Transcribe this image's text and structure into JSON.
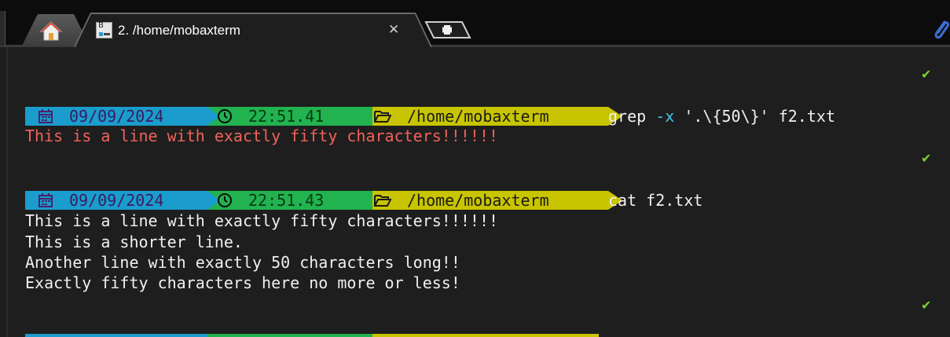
{
  "tabs": {
    "home_icon": "home-icon",
    "session": {
      "title": "2. /home/mobaxterm",
      "close_label": "✕",
      "icon": "terminal-icon"
    },
    "new_tab_icon": "plus-icon",
    "attach_icon": "paperclip-icon"
  },
  "terminal": {
    "status_check": "✔",
    "blocks": [
      {
        "date_icon": "calendar-icon",
        "date": "09/09/2024",
        "time_icon": "clock-icon",
        "time": "22:51.41",
        "folder_icon": "folder-icon",
        "path": "/home/mobaxterm",
        "command_name": "grep ",
        "command_flag": "-x",
        "command_args": " '.\\{50\\}' f2.txt",
        "output": [
          "This is a line with exactly fifty characters!!!!!!"
        ]
      },
      {
        "date_icon": "calendar-icon",
        "date": "09/09/2024",
        "time_icon": "clock-icon",
        "time": "22:51.43",
        "folder_icon": "folder-icon",
        "path": "/home/mobaxterm",
        "command_name": "cat f2.txt",
        "output": [
          "This is a line with exactly fifty characters!!!!!!",
          "This is a shorter line.",
          "Another line with exactly 50 characters long!!",
          "Exactly fifty characters here no more or less!"
        ]
      }
    ]
  },
  "colors": {
    "date_segment": "#1a9ccc",
    "time_segment": "#22b24f",
    "path_segment": "#c8c400",
    "match_output": "#f1625a",
    "flag": "#3ec7e6",
    "check": "#7bd12a"
  }
}
